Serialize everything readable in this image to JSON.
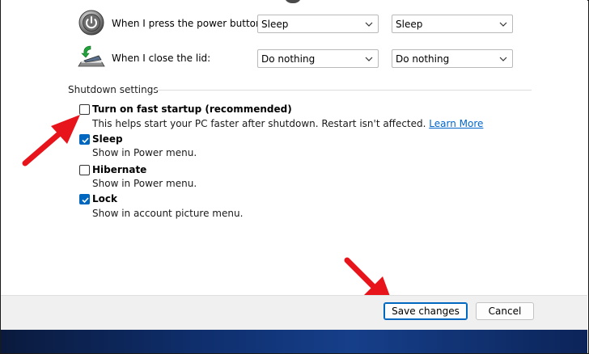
{
  "power_rows": [
    {
      "label": "When I press the power button:",
      "on_battery": "Sleep",
      "plugged_in": "Sleep",
      "icon": "power-button-icon"
    },
    {
      "label": "When I close the lid:",
      "on_battery": "Do nothing",
      "plugged_in": "Do nothing",
      "icon": "laptop-lid-icon"
    }
  ],
  "shutdown": {
    "title": "Shutdown settings",
    "options": [
      {
        "label": "Turn on fast startup (recommended)",
        "checked": false,
        "description": "This helps start your PC faster after shutdown. Restart isn't affected.",
        "link": "Learn More"
      },
      {
        "label": "Sleep",
        "checked": true,
        "description": "Show in Power menu."
      },
      {
        "label": "Hibernate",
        "checked": false,
        "description": "Show in Power menu."
      },
      {
        "label": "Lock",
        "checked": true,
        "description": "Show in account picture menu."
      }
    ]
  },
  "buttons": {
    "save": "Save changes",
    "cancel": "Cancel"
  },
  "colors": {
    "accent": "#0067c0",
    "annotation_arrow": "#e8141c",
    "link": "#0066cc"
  }
}
